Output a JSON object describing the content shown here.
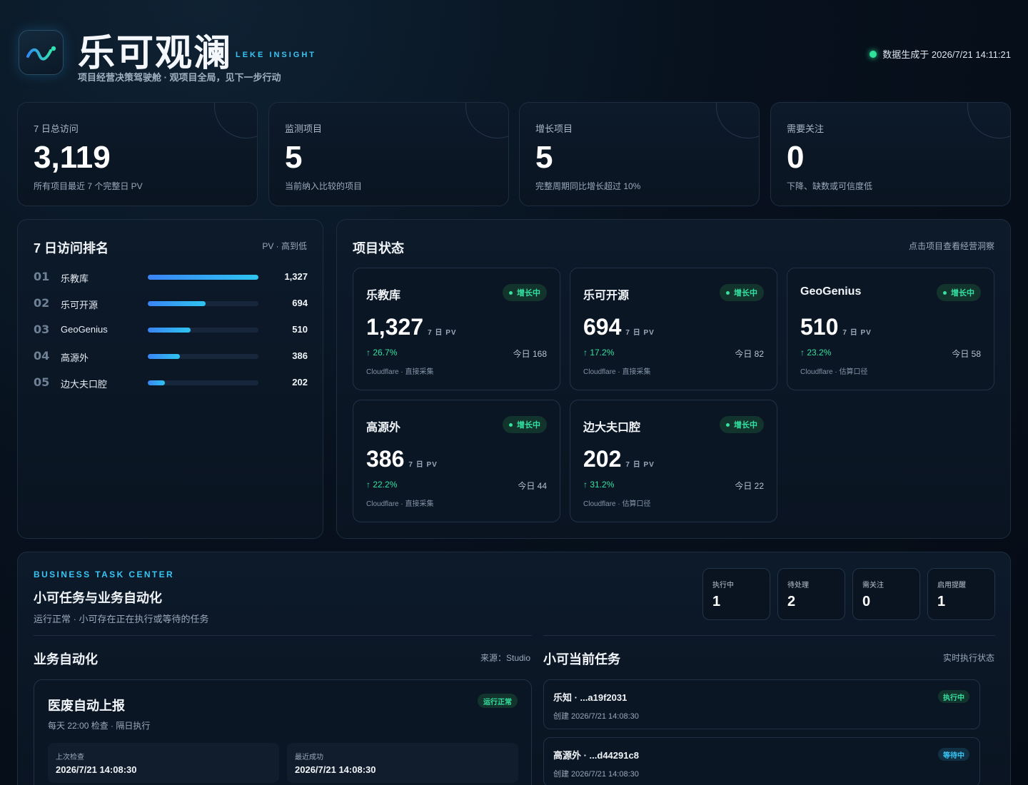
{
  "header": {
    "title": "乐可观澜",
    "subtitle_en": "LEKE INSIGHT",
    "tagline": "项目经营决策驾驶舱 · 观项目全局，见下一步行动",
    "generated": "数据生成于 2026/7/21 14:11:21"
  },
  "stats": [
    {
      "label": "7 日总访问",
      "value": "3,119",
      "desc": "所有项目最近 7 个完整日 PV"
    },
    {
      "label": "监测项目",
      "value": "5",
      "desc": "当前纳入比较的项目"
    },
    {
      "label": "增长项目",
      "value": "5",
      "desc": "完整周期同比增长超过 10%"
    },
    {
      "label": "需要关注",
      "value": "0",
      "desc": "下降、缺数或可信度低"
    }
  ],
  "ranking": {
    "title": "7 日访问排名",
    "hint": "PV · 高到低",
    "max": 1327,
    "rows": [
      {
        "no": "01",
        "name": "乐教库",
        "value": 1327,
        "display": "1,327"
      },
      {
        "no": "02",
        "name": "乐可开源",
        "value": 694,
        "display": "694"
      },
      {
        "no": "03",
        "name": "GeoGenius",
        "value": 510,
        "display": "510"
      },
      {
        "no": "04",
        "name": "高源外",
        "value": 386,
        "display": "386"
      },
      {
        "no": "05",
        "name": "边大夫口腔",
        "value": 202,
        "display": "202"
      }
    ]
  },
  "projects": {
    "title": "项目状态",
    "hint": "点击项目查看经营洞察",
    "pv_unit": "7 日 PV",
    "items": [
      {
        "name": "乐教库",
        "status": "增长中",
        "pv": "1,327",
        "growth": "↑ 26.7%",
        "today": "今日 168",
        "source": "Cloudflare · 直接采集"
      },
      {
        "name": "乐可开源",
        "status": "增长中",
        "pv": "694",
        "growth": "↑ 17.2%",
        "today": "今日 82",
        "source": "Cloudflare · 直接采集"
      },
      {
        "name": "GeoGenius",
        "status": "增长中",
        "pv": "510",
        "growth": "↑ 23.2%",
        "today": "今日 58",
        "source": "Cloudflare · 估算口径"
      },
      {
        "name": "高源外",
        "status": "增长中",
        "pv": "386",
        "growth": "↑ 22.2%",
        "today": "今日 44",
        "source": "Cloudflare · 直接采集"
      },
      {
        "name": "边大夫口腔",
        "status": "增长中",
        "pv": "202",
        "growth": "↑ 31.2%",
        "today": "今日 22",
        "source": "Cloudflare · 估算口径"
      }
    ]
  },
  "tasks": {
    "label_en": "BUSINESS TASK CENTER",
    "title": "小可任务与业务自动化",
    "subtitle": "运行正常 · 小可存在正在执行或等待的任务",
    "counters": [
      {
        "label": "执行中",
        "value": "1"
      },
      {
        "label": "待处理",
        "value": "2"
      },
      {
        "label": "需关注",
        "value": "0"
      },
      {
        "label": "启用提醒",
        "value": "1"
      }
    ],
    "automation": {
      "title": "业务自动化",
      "source": "来源：Studio",
      "card": {
        "name": "医废自动上报",
        "schedule": "每天 22:00 检查 · 隔日执行",
        "status": "运行正常",
        "last_check_label": "上次检查",
        "last_check": "2026/7/21 14:08:30",
        "last_success_label": "最近成功",
        "last_success": "2026/7/21 14:08:30"
      }
    },
    "current": {
      "title": "小可当前任务",
      "hint": "实时执行状态",
      "items": [
        {
          "name": "乐知 · ...a19f2031",
          "created": "创建 2026/7/21 14:08:30",
          "status": "执行中"
        },
        {
          "name": "高源外 · ...d44291c8",
          "created": "创建 2026/7/21 14:08:30",
          "status": "等待中"
        }
      ]
    }
  }
}
